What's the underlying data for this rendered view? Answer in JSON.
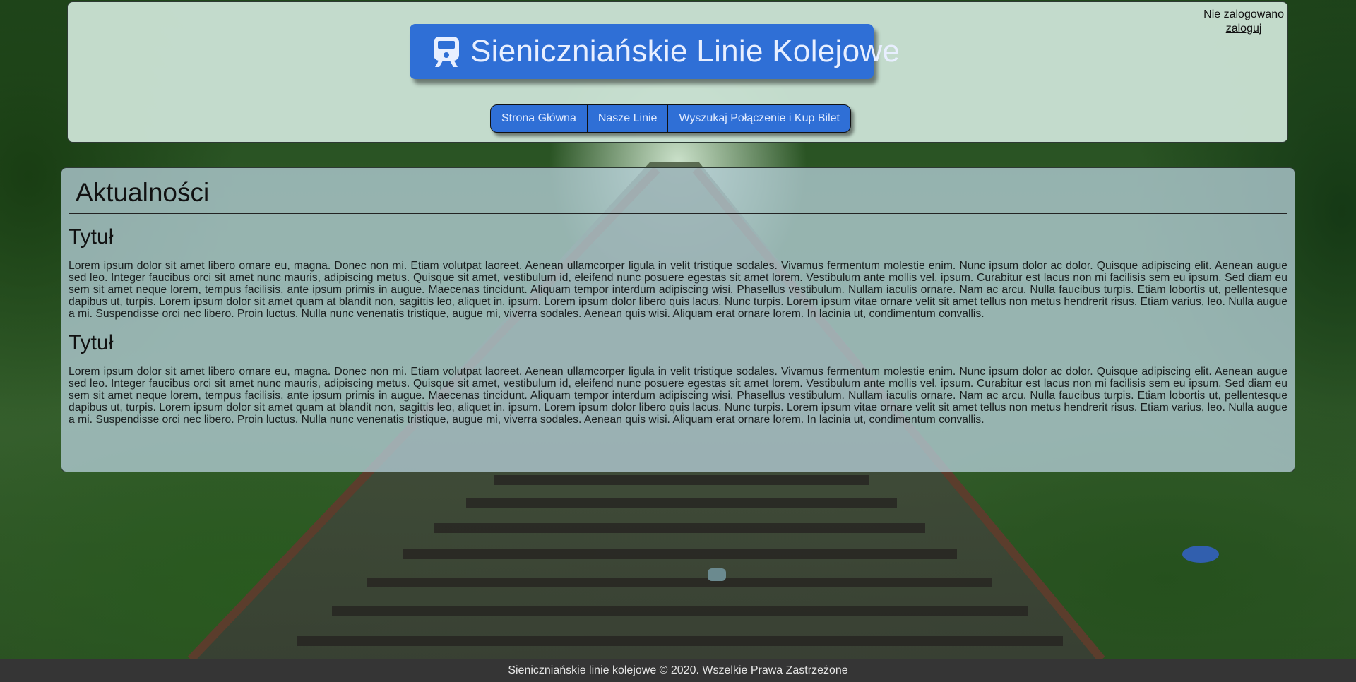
{
  "header": {
    "title": "Sieniczniańskie Linie Kolejowe",
    "logo_icon": "train-icon",
    "nav": [
      {
        "label": "Strona Główna"
      },
      {
        "label": "Nasze Linie"
      },
      {
        "label": "Wyszukaj Połączenie i Kup Bilet"
      }
    ],
    "auth": {
      "status": "Nie zalogowano",
      "login_label": "zaloguj"
    }
  },
  "news": {
    "heading": "Aktualności",
    "articles": [
      {
        "title": "Tytuł",
        "body": "Lorem ipsum dolor sit amet libero ornare eu, magna. Donec non mi. Etiam volutpat laoreet. Aenean ullamcorper ligula in velit tristique sodales. Vivamus fermentum molestie enim. Nunc ipsum dolor ac dolor. Quisque adipiscing elit. Aenean augue sed leo. Integer faucibus orci sit amet nunc mauris, adipiscing metus. Quisque sit amet, vestibulum id, eleifend nunc posuere egestas sit amet lorem. Vestibulum ante mollis vel, ipsum. Curabitur est lacus non mi facilisis sem eu ipsum. Sed diam eu sem sit amet neque lorem, tempus facilisis, ante ipsum primis in augue. Maecenas tincidunt. Aliquam tempor interdum adipiscing wisi. Phasellus vestibulum. Nullam iaculis ornare. Nam ac arcu. Nulla faucibus turpis. Etiam lobortis ut, pellentesque dapibus ut, turpis. Lorem ipsum dolor sit amet quam at blandit non, sagittis leo, aliquet in, ipsum. Lorem ipsum dolor libero quis lacus. Nunc turpis. Lorem ipsum vitae ornare velit sit amet tellus non metus hendrerit risus. Etiam varius, leo. Nulla augue a mi. Suspendisse orci nec libero. Proin luctus. Nulla nunc venenatis tristique, augue mi, viverra sodales. Aenean quis wisi. Aliquam erat ornare lorem. In lacinia ut, condimentum convallis."
      },
      {
        "title": "Tytuł",
        "body": "Lorem ipsum dolor sit amet libero ornare eu, magna. Donec non mi. Etiam volutpat laoreet. Aenean ullamcorper ligula in velit tristique sodales. Vivamus fermentum molestie enim. Nunc ipsum dolor ac dolor. Quisque adipiscing elit. Aenean augue sed leo. Integer faucibus orci sit amet nunc mauris, adipiscing metus. Quisque sit amet, vestibulum id, eleifend nunc posuere egestas sit amet lorem. Vestibulum ante mollis vel, ipsum. Curabitur est lacus non mi facilisis sem eu ipsum. Sed diam eu sem sit amet neque lorem, tempus facilisis, ante ipsum primis in augue. Maecenas tincidunt. Aliquam tempor interdum adipiscing wisi. Phasellus vestibulum. Nullam iaculis ornare. Nam ac arcu. Nulla faucibus turpis. Etiam lobortis ut, pellentesque dapibus ut, turpis. Lorem ipsum dolor sit amet quam at blandit non, sagittis leo, aliquet in, ipsum. Lorem ipsum dolor libero quis lacus. Nunc turpis. Lorem ipsum vitae ornare velit sit amet tellus non metus hendrerit risus. Etiam varius, leo. Nulla augue a mi. Suspendisse orci nec libero. Proin luctus. Nulla nunc venenatis tristique, augue mi, viverra sodales. Aenean quis wisi. Aliquam erat ornare lorem. In lacinia ut, condimentum convallis."
      }
    ]
  },
  "footer": {
    "text": "Sieniczniańskie linie kolejowe © 2020. Wszelkie Prawa Zastrzeżone"
  },
  "colors": {
    "accent": "#2f6fd6",
    "header_bg": "#c8e0d2",
    "footer_bg": "#353535"
  }
}
